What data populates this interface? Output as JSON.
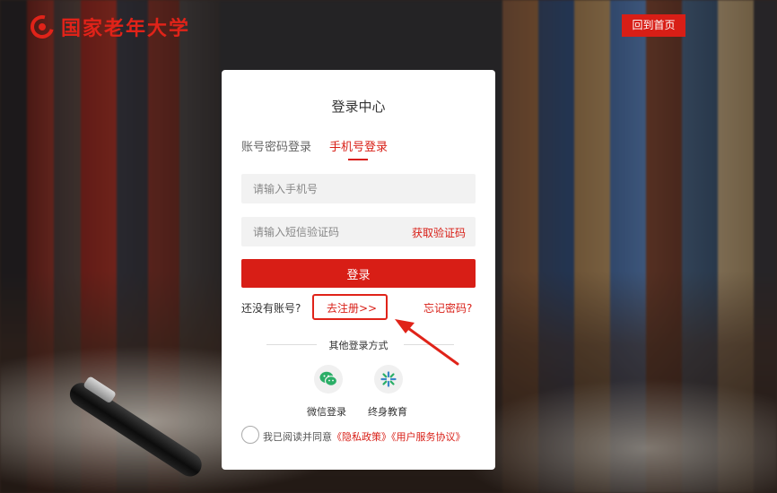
{
  "header": {
    "logo_text": "国家老年大学",
    "home_button": "回到首页"
  },
  "login": {
    "title": "登录中心",
    "tabs": [
      {
        "label": "账号密码登录",
        "active": false
      },
      {
        "label": "手机号登录",
        "active": true
      }
    ],
    "phone_placeholder": "请输入手机号",
    "code_placeholder": "请输入短信验证码",
    "get_code": "获取验证码",
    "submit": "登录",
    "no_account": "还没有账号?",
    "register": "去注册>>",
    "forgot": "忘记密码?",
    "other_methods": "其他登录方式",
    "social": [
      {
        "label": "微信登录",
        "icon": "wechat-icon"
      },
      {
        "label": "终身教育",
        "icon": "lifelong-education-icon"
      }
    ],
    "agreement": {
      "prefix": "我已阅读并同意",
      "privacy": "《隐私政策》",
      "terms": "《用户服务协议》"
    }
  },
  "colors": {
    "accent": "#d81e16",
    "wechat": "#2aae67",
    "lifelong": "#3a86c8"
  }
}
